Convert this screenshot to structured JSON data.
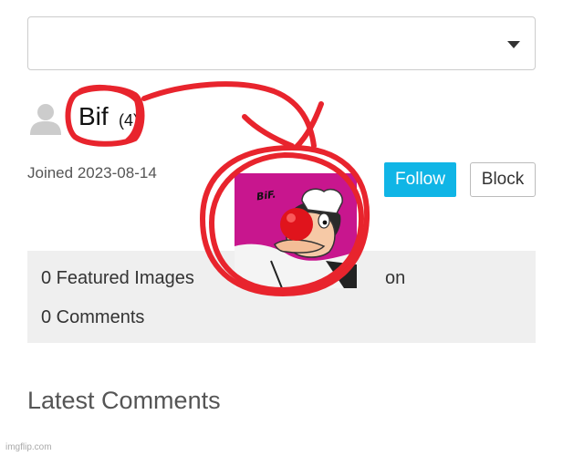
{
  "dropdown": {
    "selected_value": "",
    "caret_icon": "chevron-down-icon"
  },
  "user": {
    "avatar_icon": "user-silhouette-icon",
    "name": "Bif",
    "points": "(4)",
    "joined": "Joined 2023-08-14"
  },
  "actions": {
    "follow_label": "Follow",
    "block_label": "Block"
  },
  "stats": {
    "featured": "0 Featured Images",
    "featured_suffix": "on",
    "comments": "0 Comments"
  },
  "latest_comments_heading": "Latest Comments",
  "pasted_image": {
    "caption": "BiF."
  },
  "watermark": "imgflip.com",
  "colors": {
    "follow_button": "#10b5e6",
    "annotation_red": "#e8242d",
    "image_background": "#c8168e",
    "stats_background": "#efefef"
  }
}
